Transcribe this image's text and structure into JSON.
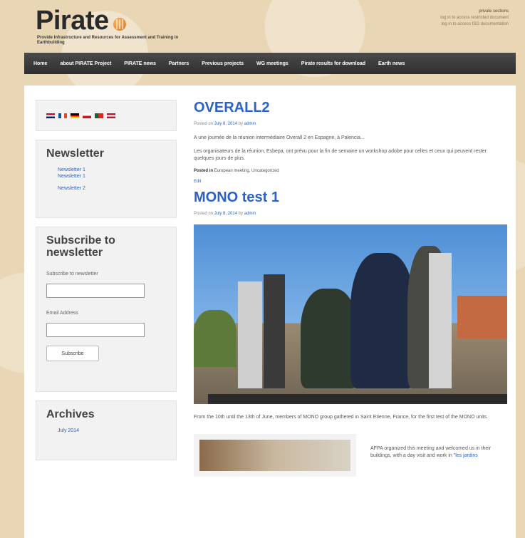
{
  "site": {
    "logo_text": "Pirate",
    "tagline": "Provide Infrastructure and Resources for Assessment and Training in Earthbuilding",
    "header_right": [
      "private sections",
      "log in to access restricted document",
      "log in to access ISG documentation"
    ]
  },
  "nav": {
    "items": [
      "Home",
      "about PIRATE Project",
      "PIRATE news",
      "Partners",
      "Previous projects",
      "WG meetings",
      "Pirate results for download",
      "Earth news"
    ]
  },
  "sidebar": {
    "flags": [
      {
        "name": "english-flag-icon",
        "color": "#c8102e"
      },
      {
        "name": "french-flag-icon",
        "color": "#0055a4"
      },
      {
        "name": "german-flag-icon",
        "color": "#000000"
      },
      {
        "name": "czech-flag-icon",
        "color": "#d7141a"
      },
      {
        "name": "portuguese-flag-icon",
        "color": "#046a38"
      },
      {
        "name": "austrian-flag-icon",
        "color": "#c8102e"
      }
    ],
    "newsletter": {
      "title": "Newsletter",
      "links": [
        "Newsletter 1",
        "Newsletter 1",
        "Newsletter 2"
      ]
    },
    "subscribe": {
      "title": "Subscribe to newsletter",
      "label1": "Subscribe to newsletter",
      "label2": "Email Address",
      "button": "Subscribe"
    },
    "archives": {
      "title": "Archives",
      "links": [
        "July 2014"
      ]
    }
  },
  "posts": [
    {
      "title": "OVERALL2",
      "meta_prefix": "Posted on",
      "date": "July 8, 2014",
      "meta_by": "by",
      "author": "admin",
      "paragraphs": [
        "A une journée de la réunion intermédiaire Overall 2 en Espagne, à Palencia...",
        "Les organisateurs de la réunion, Esbepa, ont prévu pour la fin de semaine un workshop adobe pour celles et ceux qui peuvent rester quelques jours de plus."
      ],
      "filed_label": "Posted in",
      "filed_value": "European meeting, Uncategorized",
      "edit": "Edit"
    },
    {
      "title": "MONO test 1",
      "meta_prefix": "Posted on",
      "date": "July 8, 2014",
      "meta_by": "by",
      "author": "admin",
      "caption": "From the 10th until the 13th of June, members of MONO group gathered in Saint Etienne, France, for the first test of the MONO units.",
      "side_text_1": "AFPA organized this meeting and welcomed us in their buildings, with a day visit and work in",
      "side_link": "\"les jardins"
    }
  ]
}
